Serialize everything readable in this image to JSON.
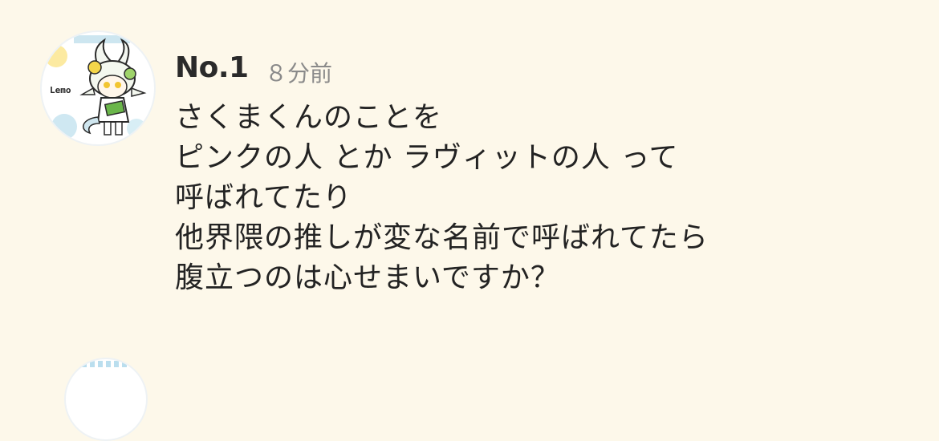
{
  "post": {
    "avatar_label": "Lemo",
    "number": "No.1",
    "time": "８分前",
    "lines": [
      "さくまくんのことを",
      "ピンクの人 とか ラヴィットの人 って",
      "呼ばれてたり",
      "他界隈の推しが変な名前で呼ばれてたら",
      "腹立つのは心せまいですか？"
    ]
  },
  "colors": {
    "background": "#fdf8ea",
    "text": "#232323",
    "muted": "#8a8a8a"
  },
  "icons": {
    "avatar": "character-avatar-icon"
  }
}
